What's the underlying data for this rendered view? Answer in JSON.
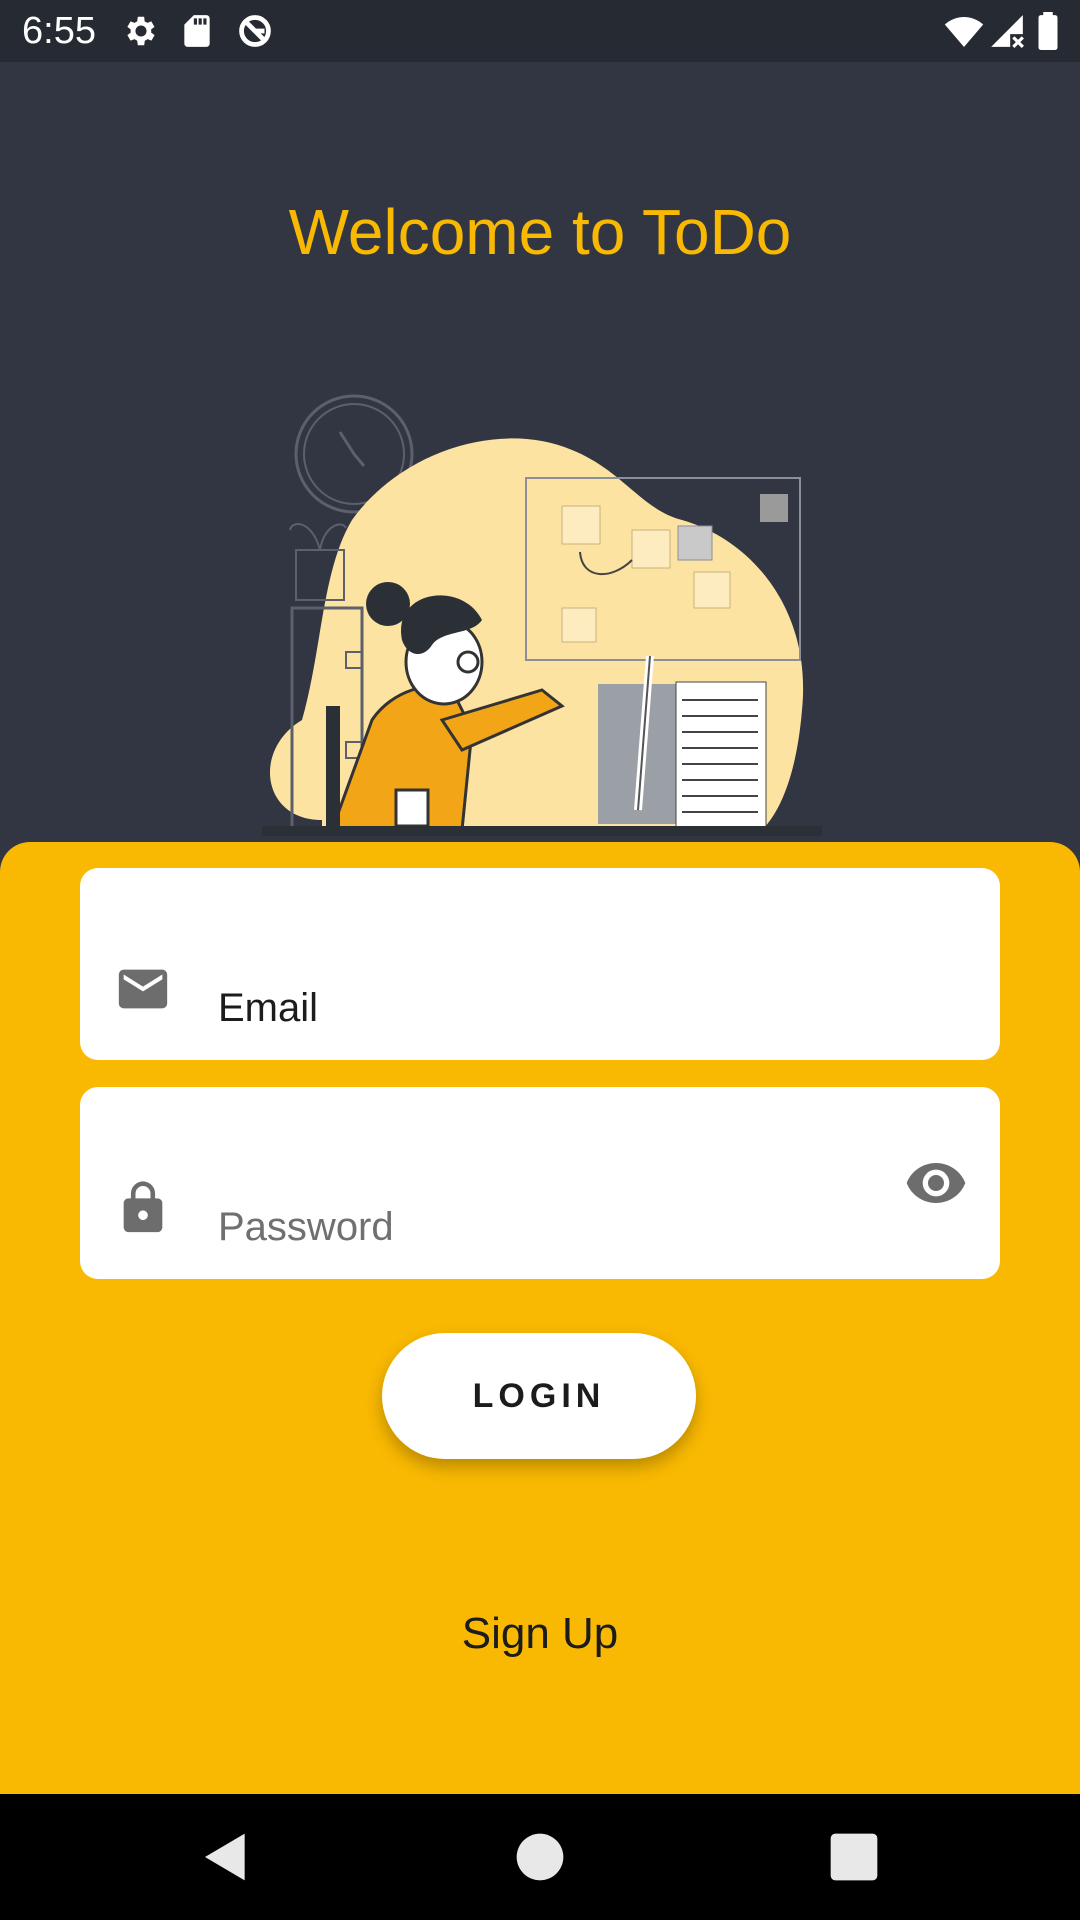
{
  "status_bar": {
    "time": "6:55",
    "left_icons": [
      "gear-icon",
      "sd-card-icon",
      "sync-icon"
    ],
    "right_icons": [
      "wifi-icon",
      "cell-signal-icon",
      "battery-icon"
    ]
  },
  "title": "Welcome to ToDo",
  "illustration": "woman-working-at-computer-illustration",
  "email_field": {
    "icon": "envelope-icon",
    "label": "Email"
  },
  "password_field": {
    "icon": "lock-icon",
    "label": "Password",
    "toggle_icon": "eye-icon"
  },
  "login_button": {
    "label": "LOGIN"
  },
  "signup_link": {
    "label": "Sign Up"
  },
  "nav_bar": [
    "back-icon",
    "home-icon",
    "recents-icon"
  ],
  "colors": {
    "background": "#323642",
    "accent": "#f9b801",
    "status_bar": "#262a33",
    "field_background": "#ffffff",
    "icon_gray": "#6d6d6d"
  }
}
